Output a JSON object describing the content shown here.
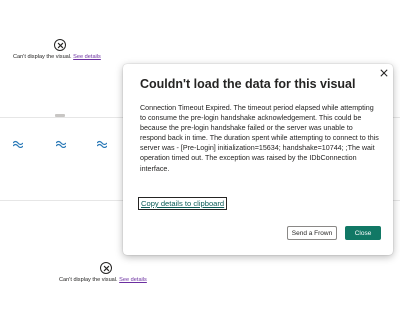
{
  "visual_error_top": {
    "message": "Can't display the visual.",
    "link": "See details"
  },
  "visual_error_bottom": {
    "message": "Can't display the visual.",
    "link": "See details"
  },
  "dialog": {
    "title": "Couldn't load the data for this visual",
    "body": "Connection Timeout Expired.  The timeout period elapsed while attempting to consume the pre-login handshake acknowledgement. This could be because the pre-login handshake failed or the server was unable to respond back in time.  The duration spent while attempting to connect to this server was - [Pre-Login] initialization=15634; handshake=10744; ;The wait operation timed out. The exception was raised by the IDbConnection interface.",
    "copy_link": "Copy details to clipboard",
    "send_frown_label": "Send a Frown",
    "close_label": "Close",
    "close_icon": "close-icon"
  },
  "colors": {
    "primary_button": "#117865",
    "link": "#6b2fa0",
    "copy_link": "#0e5d59"
  }
}
